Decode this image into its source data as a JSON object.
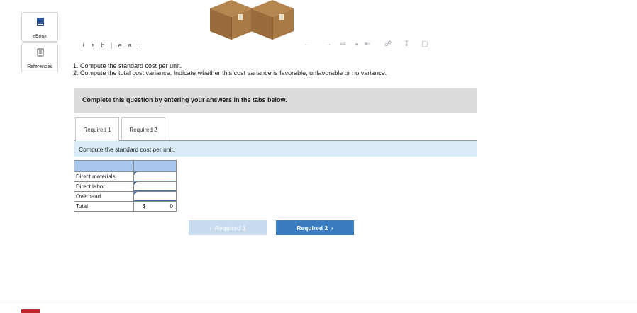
{
  "sidebar": {
    "ebook_label": "eBook",
    "references_label": "References"
  },
  "tableau": {
    "logo_text": "+ a b | e a u"
  },
  "toolbar": {
    "icons": [
      "back-arrow",
      "forward-arrow",
      "share",
      "dropdown",
      "first",
      "network",
      "download",
      "fullscreen"
    ]
  },
  "instructions": {
    "line1": "1. Compute the standard cost per unit.",
    "line2": "2. Compute the total cost variance. Indicate whether this cost variance is favorable, unfavorable or no variance."
  },
  "banner": {
    "text": "Complete this question by entering your answers in the tabs below."
  },
  "tabs": [
    {
      "label": "Required 1"
    },
    {
      "label": "Required 2"
    }
  ],
  "subheading": "Compute the standard cost per unit.",
  "cost_table": {
    "rows": [
      {
        "label": "Direct materials",
        "value": ""
      },
      {
        "label": "Direct labor",
        "value": ""
      },
      {
        "label": "Overhead",
        "value": ""
      }
    ],
    "total_label": "Total",
    "total_currency": "$",
    "total_value": "0"
  },
  "nav": {
    "prev_label": "Required 1",
    "next_label": "Required 2"
  },
  "colors": {
    "accent": "#3a7cc2",
    "header_fill": "#a8c7ec",
    "subhead_fill": "#d9ecf8"
  }
}
